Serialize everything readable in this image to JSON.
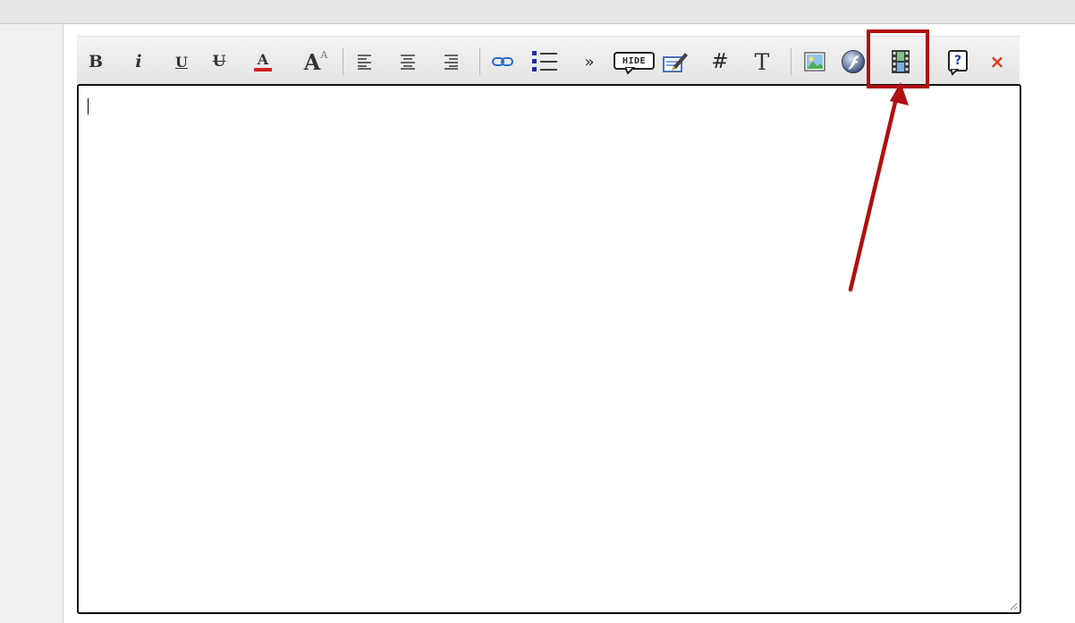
{
  "toolbar": {
    "bold_glyph": "B",
    "italic_glyph": "i",
    "underline_glyph": "U",
    "strike_glyph": "U",
    "color_glyph": "A",
    "size_glyph": "A",
    "size_sup_glyph": "A",
    "quote_glyph": "»",
    "hide_label": "HIDE",
    "hash_glyph": "#",
    "text_glyph": "T",
    "help_glyph": "?",
    "close_glyph": "×"
  },
  "editor": {
    "content": ""
  },
  "colors": {
    "highlight": "#b00f10",
    "link_icon": "#2a6cc8",
    "list_icon": "#1a2fa8",
    "close_icon": "#e0391b",
    "font_color_bar": "#d62020"
  }
}
